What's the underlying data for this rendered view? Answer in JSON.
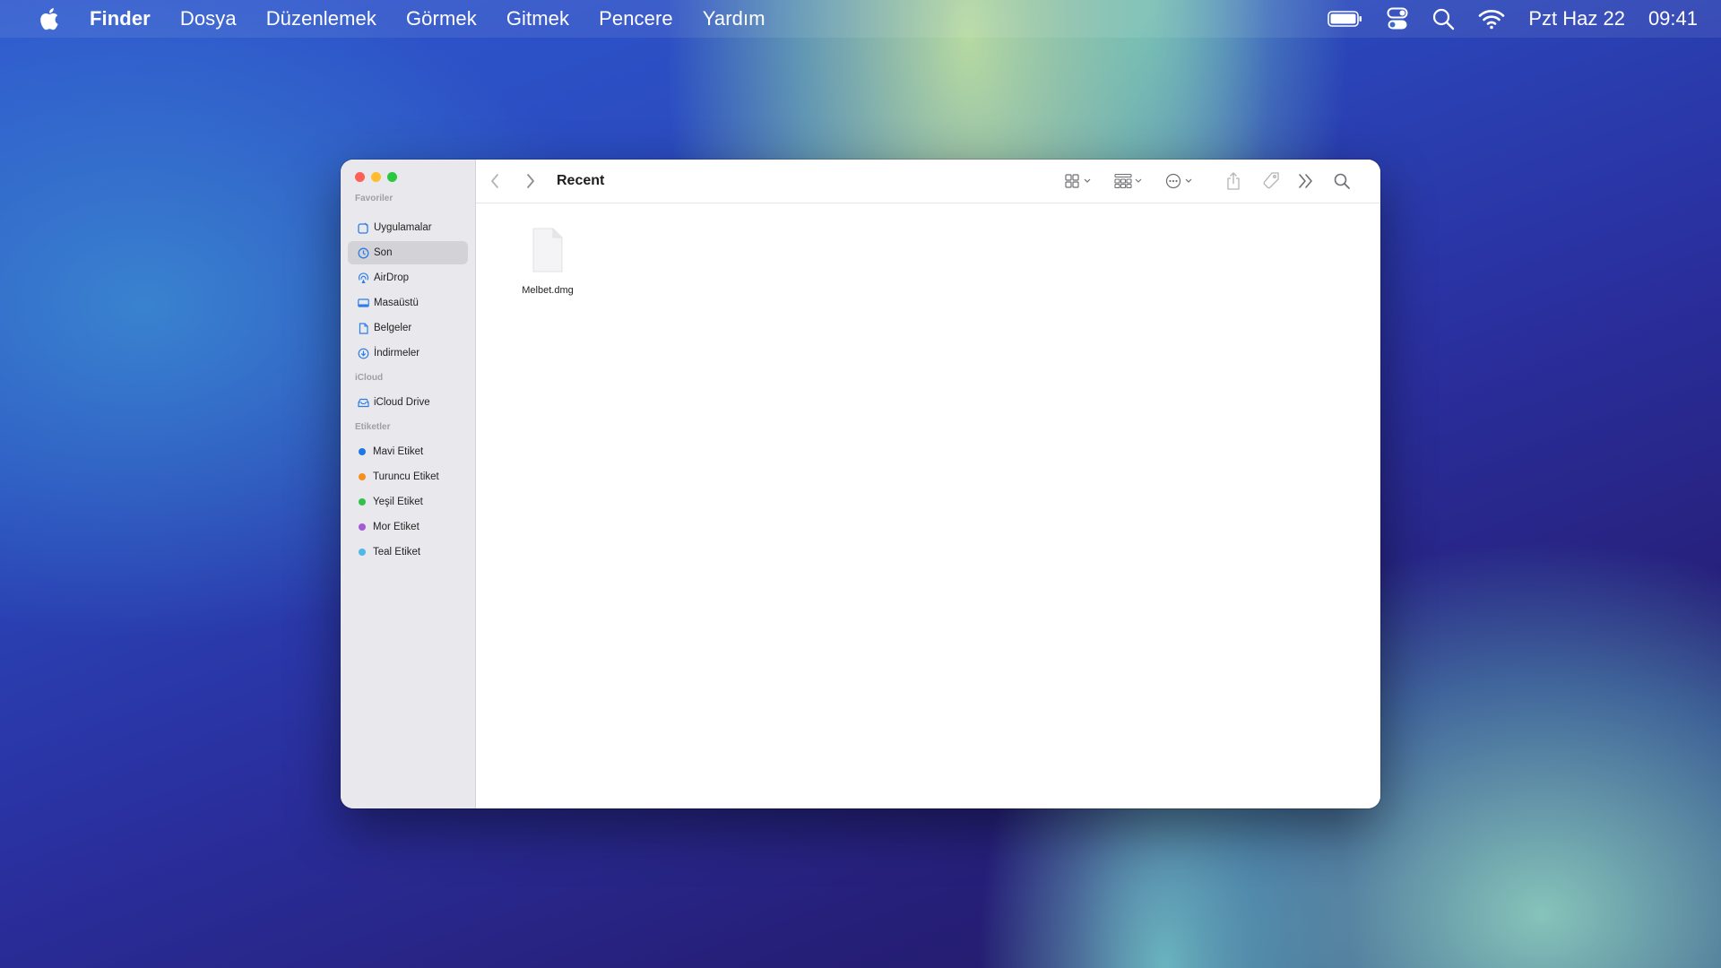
{
  "menubar": {
    "app_name": "Finder",
    "items": [
      "Dosya",
      "Düzenlemek",
      "Görmek",
      "Gitmek",
      "Pencere",
      "Yardım"
    ],
    "date": "Pzt Haz 22",
    "time": "09:41"
  },
  "window": {
    "title": "Recent",
    "sidebar": {
      "favorites_header": "Favoriler",
      "favorites": [
        {
          "label": "Uygulamalar",
          "icon": "applications-icon"
        },
        {
          "label": "Son",
          "icon": "recents-icon",
          "selected": true
        },
        {
          "label": "AirDrop",
          "icon": "airdrop-icon"
        },
        {
          "label": "Masaüstü",
          "icon": "desktop-icon"
        },
        {
          "label": "Belgeler",
          "icon": "documents-icon"
        },
        {
          "label": "İndirmeler",
          "icon": "downloads-icon"
        }
      ],
      "icloud_header": "iCloud",
      "icloud": [
        {
          "label": "iCloud Drive",
          "icon": "icloud-drive-icon"
        }
      ],
      "tags_header": "Etiketler",
      "tags": [
        {
          "label": "Mavi Etiket",
          "color": "#1e78e6"
        },
        {
          "label": "Turuncu Etiket",
          "color": "#f5901e"
        },
        {
          "label": "Yeşil Etiket",
          "color": "#32c24a"
        },
        {
          "label": "Mor Etiket",
          "color": "#a45ad6"
        },
        {
          "label": "Teal Etiket",
          "color": "#4fb8e6"
        }
      ]
    },
    "files": [
      {
        "name": "Melbet.dmg",
        "icon": "document-icon"
      }
    ]
  },
  "colors": {
    "accent": "#2b7de9",
    "sidebar_bg": "#e9e8ec",
    "selected_bg": "#d3d2d7"
  }
}
